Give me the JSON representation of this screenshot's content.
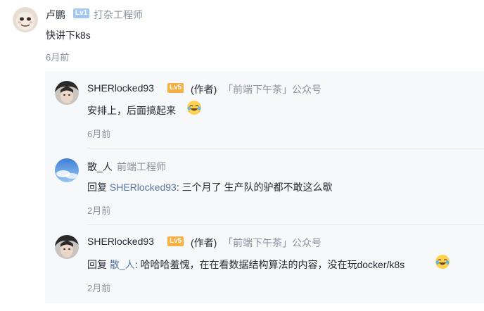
{
  "comment": {
    "author": "卢鹏",
    "level": "Lv1",
    "title": "打杂工程师",
    "text": "快讲下k8s",
    "time": "6月前"
  },
  "replies": [
    {
      "author": "SHERlocked93",
      "level": "Lv5",
      "author_tag": "(作者)",
      "org": "「前端下午茶」公众号",
      "reply_prefix": "",
      "reply_to": "",
      "text": "安排上，后面搞起来",
      "emoji": "laughing-tears-icon",
      "time": "6月前"
    },
    {
      "author": "散_人",
      "level": "",
      "title": "前端工程师",
      "reply_prefix": "回复",
      "reply_to": "SHERlocked93",
      "text": ": 三个月了 生产队的驴都不敢这么歇",
      "time": "2月前"
    },
    {
      "author": "SHERlocked93",
      "level": "Lv5",
      "author_tag": "(作者)",
      "org": "「前端下午茶」公众号",
      "reply_prefix": "回复",
      "reply_to": "散_人",
      "text": ": 哈哈哈羞愧，在在看数据结构算法的内容，没在玩docker/k8s",
      "emoji": "laughing-tears-icon",
      "time": "2月前"
    }
  ],
  "colors": {
    "link": "#5476a8",
    "muted": "#8a919f",
    "lv1_badge": "#a6c8ef",
    "lv5_badge": "#f5b041",
    "reply_bg": "#f7f8fa"
  }
}
